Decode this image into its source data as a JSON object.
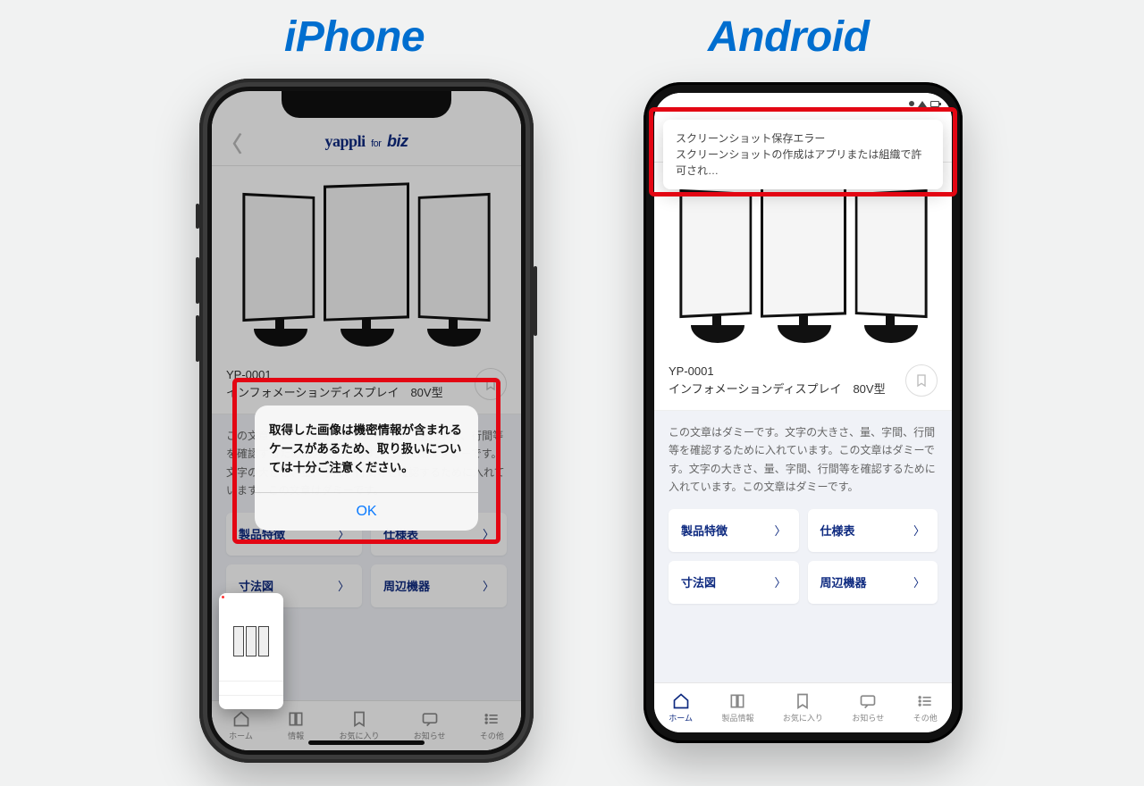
{
  "labels": {
    "iphone": "iPhone",
    "android": "Android"
  },
  "app": {
    "brand_y": "yappli",
    "brand_for": "for",
    "brand_biz": "biz",
    "product_code": "YP-0001",
    "product_name": "インフォメーションディスプレイ　80V型",
    "description": "この文章はダミーです。文字の大きさ、量、字間、行間等を確認するために入れています。この文章はダミーです。文字の大きさ、量、字間、行間等を確認するために入れています。この文章はダミーです。",
    "cards": [
      "製品特徴",
      "仕様表",
      "寸法図",
      "周辺機器"
    ],
    "tabs": [
      "ホーム",
      "製品情報",
      "お気に入り",
      "お知らせ",
      "その他"
    ]
  },
  "iphone_labeled_tab": "情報",
  "ios_alert": {
    "message": "取得した画像は機密情報が含まれるケースがあるため、取り扱いについては十分ご注意ください。",
    "ok": "OK"
  },
  "android_toast": {
    "title": "スクリーンショット保存エラー",
    "body": "スクリーンショットの作成はアプリまたは組織で許可され…"
  }
}
